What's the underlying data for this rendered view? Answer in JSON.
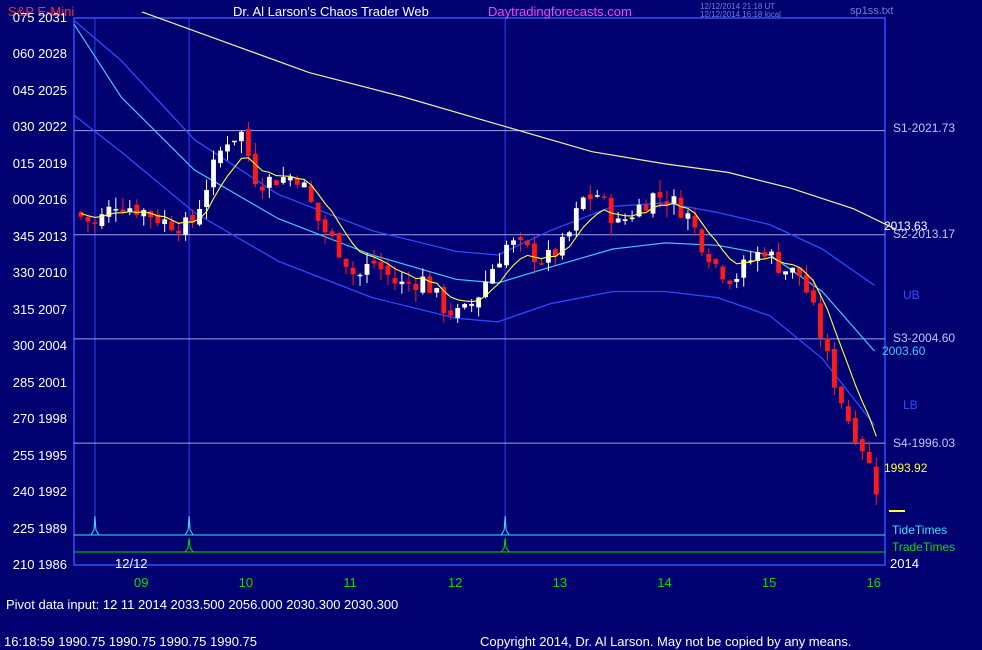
{
  "header": {
    "instrument": "S&P E-Mini",
    "site_title": "Dr. Al Larson's Chaos Trader Web",
    "site_url": "Daytradingforecasts.com",
    "timestamp_utc": "12/12/2014 21:18 UT",
    "timestamp_local": "12/12/2014 16:18 local",
    "file_name": "sp1ss.txt"
  },
  "colors": {
    "background": "#000070",
    "frame": "#3050ff",
    "candle_up": "#ffffff",
    "candle_down": "#ff1a1a",
    "yellow_avg": "#ffff40",
    "blue_band": "#2a4cff",
    "cyan_band": "#40c8ff",
    "slow_avg": "#f0f0a0",
    "tide": "#40e0ff",
    "trade": "#00e000"
  },
  "y_axis": {
    "min": 1986,
    "max": 2031,
    "labels": [
      {
        "left": "075",
        "right": "2031",
        "value": 2031
      },
      {
        "left": "060",
        "right": "2028",
        "value": 2028
      },
      {
        "left": "045",
        "right": "2025",
        "value": 2025
      },
      {
        "left": "030",
        "right": "2022",
        "value": 2022
      },
      {
        "left": "015",
        "right": "2019",
        "value": 2019
      },
      {
        "left": "000",
        "right": "2016",
        "value": 2016
      },
      {
        "left": "345",
        "right": "2013",
        "value": 2013
      },
      {
        "left": "330",
        "right": "2010",
        "value": 2010
      },
      {
        "left": "315",
        "right": "2007",
        "value": 2007
      },
      {
        "left": "300",
        "right": "2004",
        "value": 2004
      },
      {
        "left": "285",
        "right": "2001",
        "value": 2001
      },
      {
        "left": "270",
        "right": "1998",
        "value": 1998
      },
      {
        "left": "255",
        "right": "1995",
        "value": 1995
      },
      {
        "left": "240",
        "right": "1992",
        "value": 1992
      },
      {
        "left": "225",
        "right": "1989",
        "value": 1989
      },
      {
        "left": "210",
        "right": "1986",
        "value": 1986
      }
    ]
  },
  "x_axis": {
    "date_label": "12/12",
    "year_label": "2014",
    "hours": [
      "09",
      "10",
      "11",
      "12",
      "13",
      "14",
      "15",
      "16"
    ]
  },
  "levels": [
    {
      "label": "S1-2021.73",
      "value": 2021.73
    },
    {
      "label": "S2-2013.17",
      "value": 2013.17
    },
    {
      "label": "S3-2004.60",
      "value": 2004.6
    },
    {
      "label": "S4-1996.03",
      "value": 1996.03
    }
  ],
  "annotations": {
    "slow_avg_value": "2013.63",
    "cyan_band_value": "2003.60",
    "yellow_avg_value": "1993.92",
    "upper_band": "UB",
    "lower_band": "LB",
    "tide_times": "TideTimes",
    "trade_times": "TradeTimes"
  },
  "footer": {
    "pivot_input": "Pivot data input: 12 11 2014 2033.500 2056.000 2030.300 2030.300",
    "last_tick": "16:18:59 1990.75 1990.75 1990.75 1990.75",
    "copyright": "Copyright 2014, Dr. Al Larson. May not be copied by any means."
  },
  "chart_data": {
    "type": "candlestick",
    "title": "S&P E-Mini",
    "x_unit": "hour of day (12/12/2014)",
    "y_unit": "price",
    "ylim": [
      1986,
      2031
    ],
    "xlim": [
      8.35,
      16.1
    ],
    "close_path": [
      [
        8.35,
        2015.0
      ],
      [
        8.55,
        2014.0
      ],
      [
        8.75,
        2015.8
      ],
      [
        9.0,
        2015.2
      ],
      [
        9.2,
        2014.3
      ],
      [
        9.45,
        2013.8
      ],
      [
        9.5,
        2014.5
      ],
      [
        9.65,
        2018.0
      ],
      [
        9.8,
        2021.0
      ],
      [
        9.95,
        2021.5
      ],
      [
        10.1,
        2017.5
      ],
      [
        10.3,
        2017.8
      ],
      [
        10.5,
        2018.0
      ],
      [
        10.7,
        2014.0
      ],
      [
        10.9,
        2011.8
      ],
      [
        11.05,
        2009.5
      ],
      [
        11.2,
        2011.0
      ],
      [
        11.45,
        2009.0
      ],
      [
        11.7,
        2009.5
      ],
      [
        11.9,
        2007.0
      ],
      [
        12.05,
        2006.5
      ],
      [
        12.2,
        2008.0
      ],
      [
        12.35,
        2010.5
      ],
      [
        12.5,
        2012.5
      ],
      [
        12.65,
        2012.0
      ],
      [
        12.85,
        2011.0
      ],
      [
        13.05,
        2012.5
      ],
      [
        13.2,
        2016.0
      ],
      [
        13.35,
        2016.5
      ],
      [
        13.55,
        2014.0
      ],
      [
        13.75,
        2015.5
      ],
      [
        13.9,
        2016.5
      ],
      [
        14.05,
        2016.0
      ],
      [
        14.2,
        2015.0
      ],
      [
        14.35,
        2012.5
      ],
      [
        14.5,
        2010.5
      ],
      [
        14.65,
        2009.5
      ],
      [
        14.8,
        2011.0
      ],
      [
        14.95,
        2012.0
      ],
      [
        15.1,
        2010.5
      ],
      [
        15.3,
        2009.8
      ],
      [
        15.45,
        2006.0
      ],
      [
        15.6,
        2001.5
      ],
      [
        15.75,
        1998.0
      ],
      [
        15.9,
        1995.5
      ],
      [
        16.05,
        1991.5
      ]
    ],
    "series": [
      {
        "name": "S1-2021.73",
        "constant": 2021.73
      },
      {
        "name": "S2-2013.17",
        "constant": 2013.17
      },
      {
        "name": "S3-2004.60",
        "constant": 2004.6
      },
      {
        "name": "S4-1996.03",
        "constant": 1996.03
      },
      {
        "name": "UB",
        "points": [
          [
            8.35,
            2030.8
          ],
          [
            8.8,
            2027.5
          ],
          [
            9.5,
            2021.0
          ],
          [
            10.3,
            2016.5
          ],
          [
            11.2,
            2013.5
          ],
          [
            12.0,
            2011.8
          ],
          [
            12.4,
            2011.5
          ],
          [
            12.9,
            2013.5
          ],
          [
            13.5,
            2015.5
          ],
          [
            14.0,
            2015.8
          ],
          [
            14.5,
            2015.0
          ],
          [
            15.0,
            2014.0
          ],
          [
            15.5,
            2012.0
          ],
          [
            16.0,
            2009.0
          ]
        ]
      },
      {
        "name": "LB",
        "points": [
          [
            8.35,
            2023.0
          ],
          [
            8.8,
            2020.0
          ],
          [
            9.5,
            2015.0
          ],
          [
            10.3,
            2011.0
          ],
          [
            11.2,
            2008.0
          ],
          [
            12.0,
            2006.3
          ],
          [
            12.4,
            2006.0
          ],
          [
            12.9,
            2007.5
          ],
          [
            13.5,
            2008.5
          ],
          [
            14.0,
            2008.5
          ],
          [
            14.5,
            2008.0
          ],
          [
            15.0,
            2006.5
          ],
          [
            15.5,
            2003.0
          ],
          [
            16.0,
            1997.5
          ]
        ]
      },
      {
        "name": "2003.60",
        "points": [
          [
            8.35,
            2030.5
          ],
          [
            8.8,
            2024.5
          ],
          [
            9.5,
            2018.5
          ],
          [
            10.3,
            2014.5
          ],
          [
            11.2,
            2011.5
          ],
          [
            12.0,
            2009.5
          ],
          [
            12.4,
            2009.2
          ],
          [
            12.9,
            2010.5
          ],
          [
            13.5,
            2012.0
          ],
          [
            14.0,
            2012.5
          ],
          [
            14.5,
            2012.3
          ],
          [
            15.0,
            2011.5
          ],
          [
            15.5,
            2008.5
          ],
          [
            16.0,
            2003.6
          ]
        ]
      },
      {
        "name": "2013.63",
        "points": [
          [
            9.0,
            2031.5
          ],
          [
            9.8,
            2029.0
          ],
          [
            10.6,
            2026.5
          ],
          [
            11.5,
            2024.5
          ],
          [
            12.5,
            2022.0
          ],
          [
            13.3,
            2020.0
          ],
          [
            14.0,
            2019.0
          ],
          [
            14.6,
            2018.3
          ],
          [
            15.2,
            2017.0
          ],
          [
            15.8,
            2015.3
          ],
          [
            16.2,
            2013.63
          ]
        ]
      },
      {
        "name": "1993.92",
        "from_close_path": true
      }
    ],
    "tide_times": [
      8.55,
      9.45,
      12.47
    ],
    "trade_times": [
      9.45,
      12.47
    ]
  }
}
